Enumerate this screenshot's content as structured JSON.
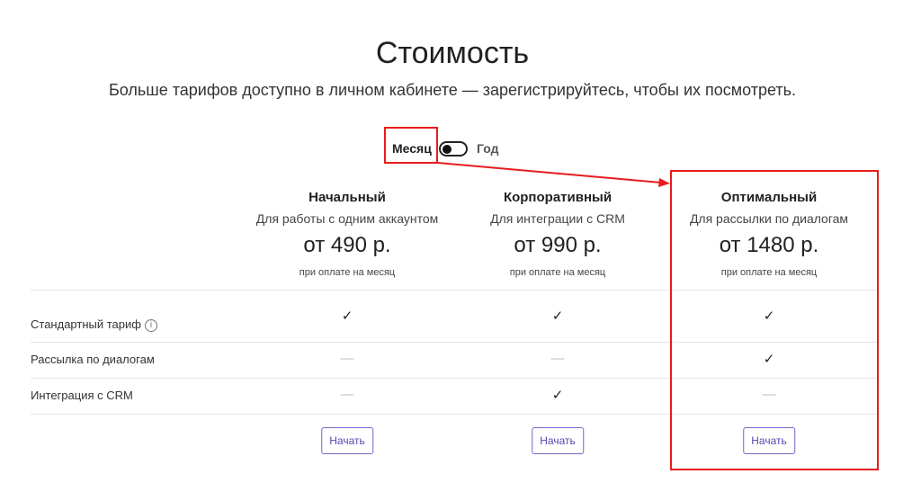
{
  "header": {
    "title": "Стоимость",
    "subtitle": "Больше тарифов доступно в личном кабинете — зарегистрируйтесь, чтобы их посмотреть."
  },
  "period": {
    "month": "Месяц",
    "year": "Год",
    "selected": "Месяц"
  },
  "plans": [
    {
      "name": "Начальный",
      "desc": "Для работы с одним аккаунтом",
      "price": "от 490 р.",
      "note": "при оплате на месяц",
      "button": "Начать"
    },
    {
      "name": "Корпоративный",
      "desc": "Для интеграции с CRM",
      "price": "от 990 р.",
      "note": "при оплате на месяц",
      "button": "Начать"
    },
    {
      "name": "Оптимальный",
      "desc": "Для рассылки по диалогам",
      "price": "от 1480 р.",
      "note": "при оплате на месяц",
      "button": "Начать"
    }
  ],
  "features": [
    {
      "label": "Стандартный тариф",
      "info": "i",
      "marks": [
        "✓",
        "✓",
        "✓"
      ]
    },
    {
      "label": "Рассылка по диалогам",
      "marks": [
        "—",
        "—",
        "✓"
      ]
    },
    {
      "label": "Интеграция с CRM",
      "marks": [
        "—",
        "✓",
        "—"
      ]
    }
  ],
  "annotation_color": "#e81c1c"
}
